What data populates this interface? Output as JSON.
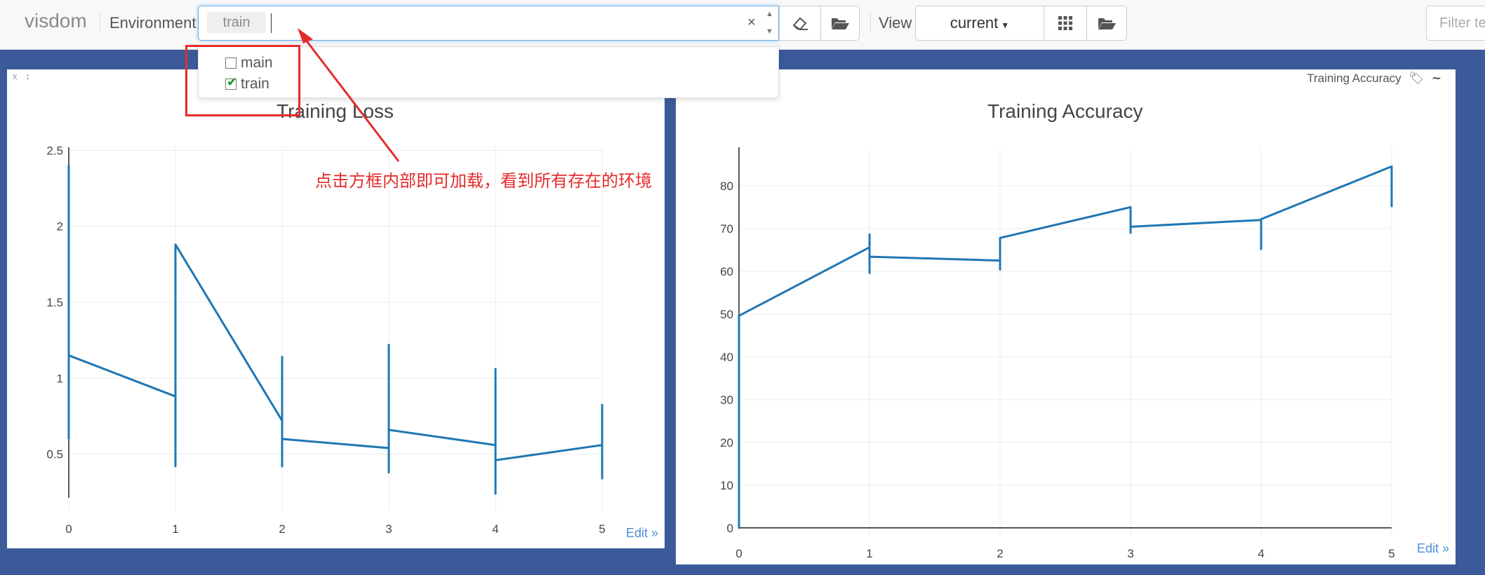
{
  "app": {
    "brand": "visdom"
  },
  "toolbar": {
    "environment_label": "Environment",
    "selected_env_chip": "train",
    "clear_symbol": "×",
    "view_label": "View",
    "view_value": "current",
    "filter_placeholder": "Filter te"
  },
  "env_dropdown": {
    "options": [
      {
        "label": "main",
        "checked": false
      },
      {
        "label": "train",
        "checked": true
      }
    ]
  },
  "annotation": {
    "text": "点击方框内部即可加载，看到所有存在的环境"
  },
  "panes": {
    "loss": {
      "title": "Training Loss",
      "edit": "Edit »",
      "tools": "x ↕"
    },
    "accuracy": {
      "title": "Training Accuracy",
      "small_title": "Training Accuracy",
      "edit": "Edit »"
    }
  },
  "chart_data": [
    {
      "type": "line",
      "title": "Training Loss",
      "xlim": [
        0,
        5
      ],
      "ylim": [
        0.12,
        2.52
      ],
      "xticks": [
        "0",
        "1",
        "2",
        "3",
        "4",
        "5"
      ],
      "yticks": [
        "0.5",
        "1",
        "1.5",
        "2",
        "2.5"
      ],
      "ytick_values": [
        0.5,
        1,
        1.5,
        2,
        2.5
      ],
      "grid": true,
      "color": "#1f77b4",
      "points": [
        [
          0,
          0.6
        ],
        [
          0,
          2.4
        ],
        [
          0,
          1.15
        ],
        [
          1,
          0.88
        ],
        [
          1,
          0.42
        ],
        [
          1,
          1.88
        ],
        [
          2,
          0.72
        ],
        [
          2,
          0.42
        ],
        [
          2,
          1.14
        ],
        [
          2,
          0.6
        ],
        [
          3,
          0.54
        ],
        [
          3,
          0.38
        ],
        [
          3,
          1.22
        ],
        [
          3,
          0.66
        ],
        [
          4,
          0.56
        ],
        [
          4,
          0.24
        ],
        [
          4,
          1.06
        ],
        [
          4,
          0.46
        ],
        [
          5,
          0.56
        ],
        [
          5,
          0.34
        ],
        [
          5,
          0.83
        ]
      ]
    },
    {
      "type": "line",
      "title": "Training Accuracy",
      "xlim": [
        0,
        5
      ],
      "ylim": [
        -2,
        89
      ],
      "xticks": [
        "0",
        "1",
        "2",
        "3",
        "4",
        "5"
      ],
      "yticks": [
        "0",
        "10",
        "20",
        "30",
        "40",
        "50",
        "60",
        "70",
        "80"
      ],
      "ytick_values": [
        0,
        10,
        20,
        30,
        40,
        50,
        60,
        70,
        80
      ],
      "grid": true,
      "color": "#1f77b4",
      "points": [
        [
          0,
          50
        ],
        [
          0,
          0
        ],
        [
          0,
          49.6
        ],
        [
          1,
          65.6
        ],
        [
          1,
          68.6
        ],
        [
          1,
          59.6
        ],
        [
          1,
          63.4
        ],
        [
          2,
          62.5
        ],
        [
          2,
          60.4
        ],
        [
          2,
          67.8
        ],
        [
          3,
          75
        ],
        [
          3,
          69
        ],
        [
          3,
          70.4
        ],
        [
          4,
          72
        ],
        [
          4,
          65.2
        ],
        [
          4,
          72.2
        ],
        [
          5,
          84.5
        ],
        [
          5,
          75
        ]
      ]
    }
  ]
}
